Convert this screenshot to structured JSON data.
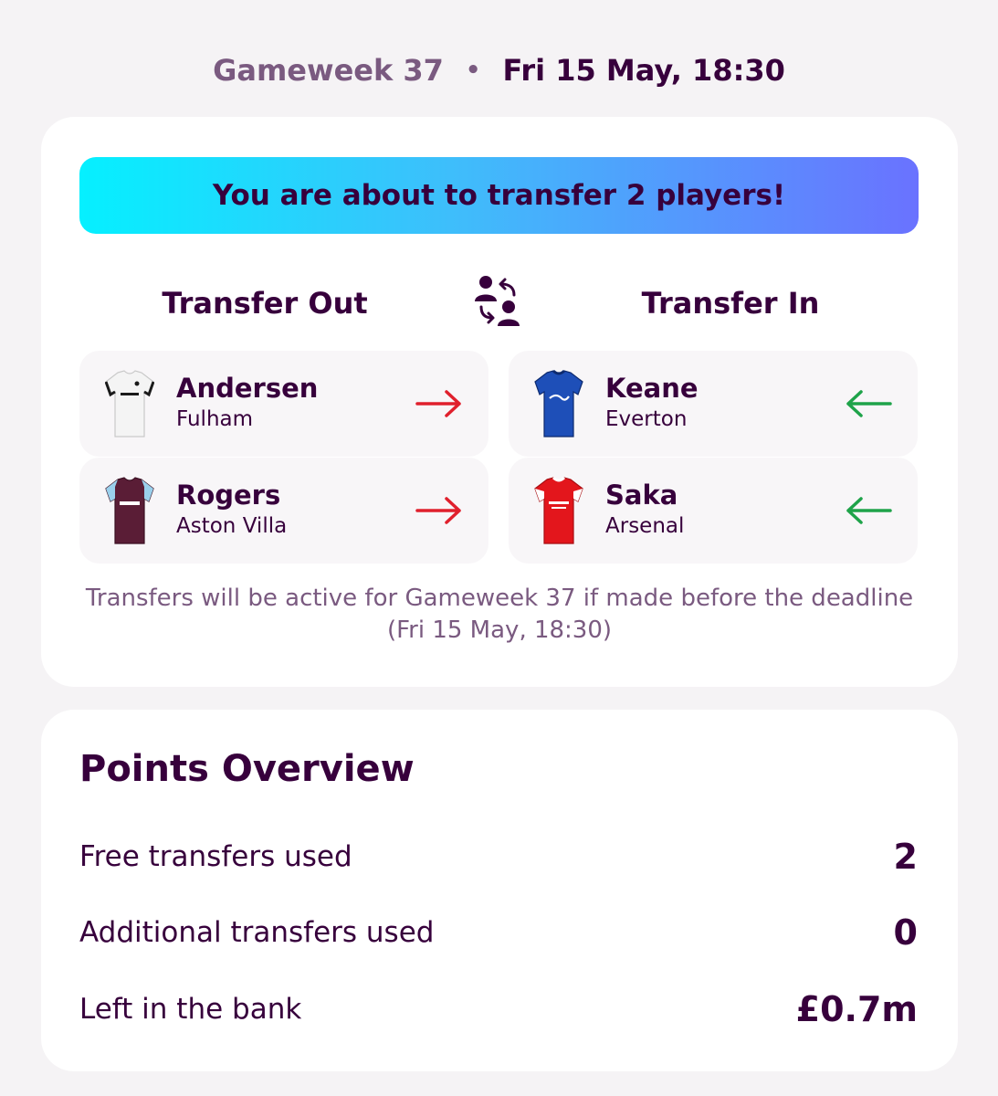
{
  "header": {
    "gameweek": "Gameweek 37",
    "separator": "•",
    "deadline": "Fri 15 May, 18:30"
  },
  "confirm_card": {
    "banner": "You are about to transfer 2 players!",
    "out_title": "Transfer Out",
    "in_title": "Transfer In",
    "transfers_out": [
      {
        "name": "Andersen",
        "team": "Fulham",
        "shirt_icon": "fulham-shirt-icon",
        "colors": {
          "main": "#f4f4f4",
          "trim": "#1a1a1a"
        }
      },
      {
        "name": "Rogers",
        "team": "Aston Villa",
        "shirt_icon": "aston-villa-shirt-icon",
        "colors": {
          "main": "#5a1d36",
          "trim": "#9ad0ec"
        }
      }
    ],
    "transfers_in": [
      {
        "name": "Keane",
        "team": "Everton",
        "shirt_icon": "everton-shirt-icon",
        "colors": {
          "main": "#1e4fb8",
          "trim": "#0d2a6e"
        }
      },
      {
        "name": "Saka",
        "team": "Arsenal",
        "shirt_icon": "arsenal-shirt-icon",
        "colors": {
          "main": "#e3161c",
          "trim": "#ffffff"
        }
      }
    ],
    "note": "Transfers will be active for Gameweek 37 if made before the deadline (Fri 15 May, 18:30)"
  },
  "overview": {
    "title": "Points Overview",
    "rows": [
      {
        "label": "Free transfers used",
        "value": "2"
      },
      {
        "label": "Additional transfers used",
        "value": "0"
      },
      {
        "label": "Left in the bank",
        "value": "£0.7m"
      }
    ]
  },
  "colors": {
    "brand_purple": "#37003c",
    "muted_purple": "#7a5a80",
    "arrow_out": "#e0202d",
    "arrow_in": "#1fa34a",
    "banner_gradient_start": "#05f0ff",
    "banner_gradient_end": "#6a72ff"
  }
}
